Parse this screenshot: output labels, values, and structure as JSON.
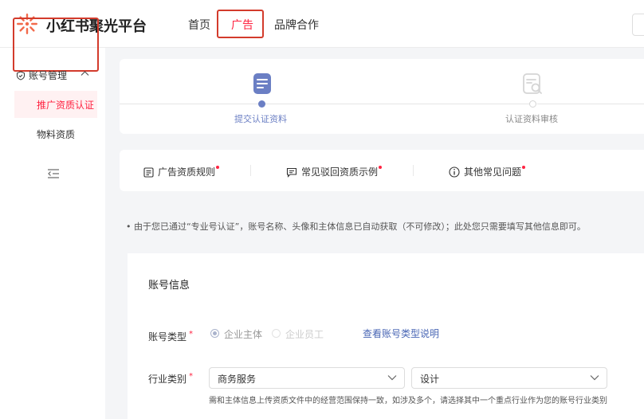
{
  "header": {
    "brand": "小红书聚光平台",
    "nav": [
      {
        "label": "首页",
        "active": false
      },
      {
        "label": "广告",
        "active": true
      },
      {
        "label": "品牌合作",
        "active": false
      }
    ]
  },
  "sidebar": {
    "group_label": "账号管理",
    "items": [
      {
        "label": "推广资质认证",
        "active": true
      },
      {
        "label": "物料资质",
        "active": false
      }
    ]
  },
  "steps": [
    {
      "label": "提交认证资料",
      "active": true
    },
    {
      "label": "认证资料审核",
      "active": false
    }
  ],
  "help_links": [
    {
      "label": "广告资质规则"
    },
    {
      "label": "常见驳回资质示例"
    },
    {
      "label": "其他常见问题"
    }
  ],
  "notice": "• 由于您已通过“专业号认证”，账号名称、头像和主体信息已自动获取（不可修改）；此处您只需要填写其他信息即可。",
  "form": {
    "section_title": "账号信息",
    "account_type": {
      "label": "账号类型",
      "options": [
        {
          "label": "企业主体",
          "checked": true
        },
        {
          "label": "企业员工",
          "checked": false
        }
      ],
      "link": "查看账号类型说明"
    },
    "industry": {
      "label": "行业类别",
      "primary": "商务服务",
      "secondary": "设计",
      "hint": "需和主体信息上传资质文件中的经营范围保持一致，如涉及多个，请选择其中一个重点行业作为您的账号行业类别"
    }
  },
  "colors": {
    "brand_red": "#ff2442",
    "highlight_box": "#d33b2c",
    "link_blue": "#4a67b5",
    "step_active": "#6b7fc4"
  },
  "icons": [
    "logo-icon",
    "shield-check-icon",
    "chevron-up-icon",
    "collapse-menu-icon",
    "document-icon",
    "document-search-icon",
    "rules-icon",
    "comment-icon",
    "info-icon",
    "chevron-down-icon"
  ]
}
